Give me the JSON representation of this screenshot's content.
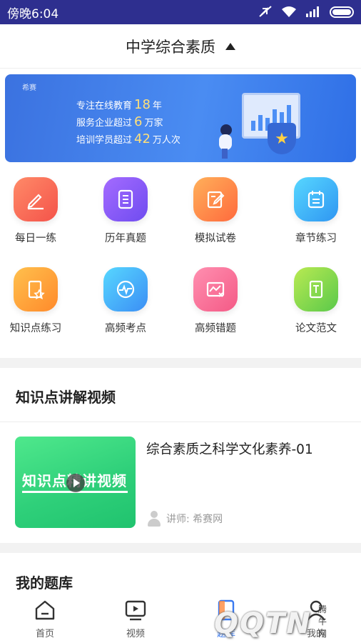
{
  "status_bar": {
    "time": "傍晚6:04"
  },
  "header": {
    "title": "中学综合素质"
  },
  "banner": {
    "brand": "希赛",
    "line1_prefix": "专注在线教育",
    "line1_num": "18",
    "line1_suffix": "年",
    "line2_prefix": "服务企业超过",
    "line2_num": "6",
    "line2_suffix": "万家",
    "line3_prefix": "培训学员超过",
    "line3_num": "42",
    "line3_suffix": "万人次"
  },
  "grid": [
    {
      "label": "每日一练",
      "icon": "pencil-icon",
      "color_from": "#ff8a68",
      "color_to": "#f4534a"
    },
    {
      "label": "历年真题",
      "icon": "document-icon",
      "color_from": "#a46bff",
      "color_to": "#6f4cf0"
    },
    {
      "label": "模拟试卷",
      "icon": "edit-paper-icon",
      "color_from": "#ffb05a",
      "color_to": "#ff6a3d"
    },
    {
      "label": "章节练习",
      "icon": "checklist-icon",
      "color_from": "#57d7ff",
      "color_to": "#2f96f2"
    },
    {
      "label": "知识点练习",
      "icon": "star-document-icon",
      "color_from": "#ffc04d",
      "color_to": "#ff8a2b"
    },
    {
      "label": "高频考点",
      "icon": "pulse-icon",
      "color_from": "#57d7ff",
      "color_to": "#3b8ef5"
    },
    {
      "label": "高频错题",
      "icon": "wrong-chart-icon",
      "color_from": "#ff8fb0",
      "color_to": "#f45a86"
    },
    {
      "label": "论文范文",
      "icon": "essay-icon",
      "color_from": "#b9ea52",
      "color_to": "#5ac94a"
    }
  ],
  "videos_section": {
    "title": "知识点讲解视频"
  },
  "video": {
    "thumb_text": "知识点精讲视频",
    "title": "综合素质之科学文化素养-01",
    "teacher": "讲师: 希赛网"
  },
  "bank_section": {
    "title": "我的题库"
  },
  "tabbar": [
    {
      "label": "首页",
      "icon": "home-icon",
      "active": false
    },
    {
      "label": "视频",
      "icon": "video-icon",
      "active": false
    },
    {
      "label": "题库",
      "icon": "question-bank-icon",
      "active": true
    },
    {
      "label": "我的",
      "icon": "profile-icon",
      "active": false
    }
  ],
  "watermark": {
    "text": "QQTN",
    "small": "腾牛网"
  },
  "colors": {
    "status_bar": "#2e2f8f",
    "accent": "#3a7af0",
    "divider": "#f2f2f2"
  }
}
